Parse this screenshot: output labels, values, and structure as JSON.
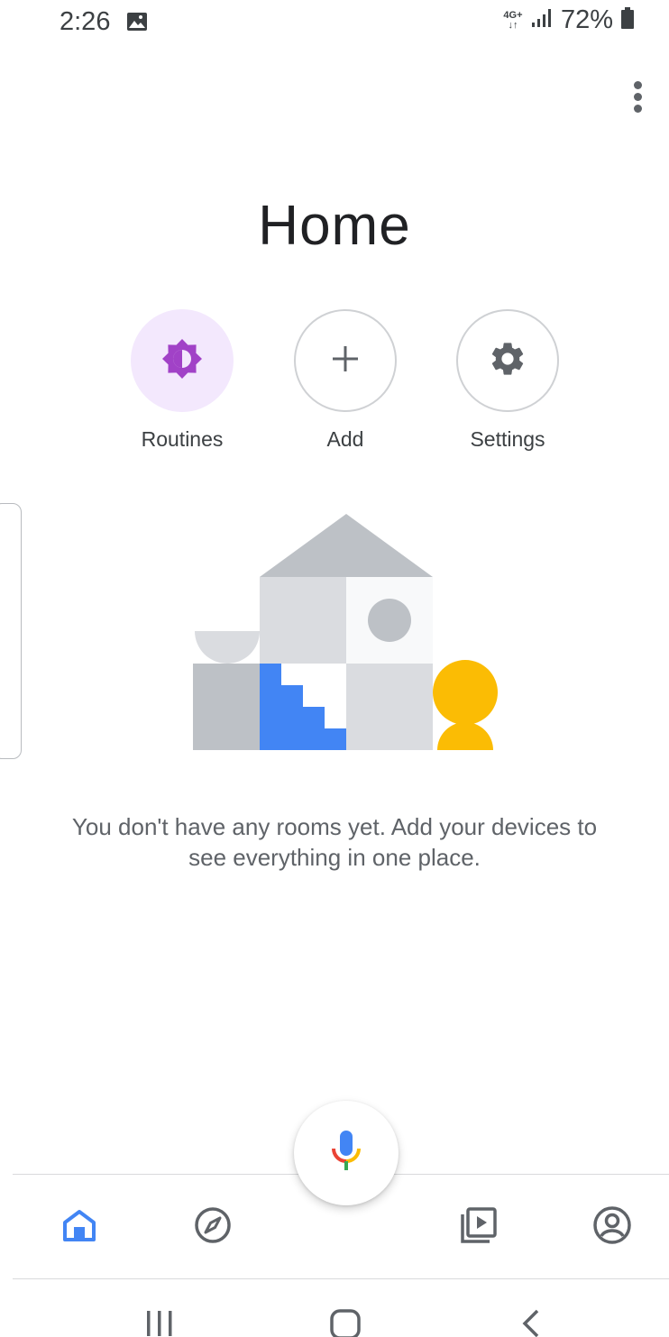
{
  "status_bar": {
    "time": "2:26",
    "network": [
      "4G+",
      "↓↑"
    ],
    "battery": "72%",
    "icons": [
      "gallery-icon",
      "signal-icon",
      "battery-icon"
    ]
  },
  "header": {
    "title": "Home",
    "overflow_icon": "more-vert-icon"
  },
  "actions": [
    {
      "label": "Routines",
      "icon": "routines-icon"
    },
    {
      "label": "Add",
      "icon": "plus-icon"
    },
    {
      "label": "Settings",
      "icon": "gear-icon"
    }
  ],
  "empty_state": {
    "message": "You don't have any rooms yet. Add your devices to see everything in one place."
  },
  "bottom_nav": {
    "items": [
      {
        "icon": "home-icon",
        "active": true
      },
      {
        "icon": "explore-icon",
        "active": false
      },
      {
        "icon": "media-icon",
        "active": false
      },
      {
        "icon": "account-icon",
        "active": false
      }
    ],
    "fab_icon": "microphone-icon"
  },
  "system_nav": [
    "recent-apps-icon",
    "home-button-icon",
    "back-icon"
  ],
  "colors": {
    "accent_blue": "#4285f4",
    "routines_purple": "#a142c7",
    "routines_bg": "#f3e8fd",
    "yellow": "#fbbc04",
    "text_secondary": "#5f6368"
  }
}
